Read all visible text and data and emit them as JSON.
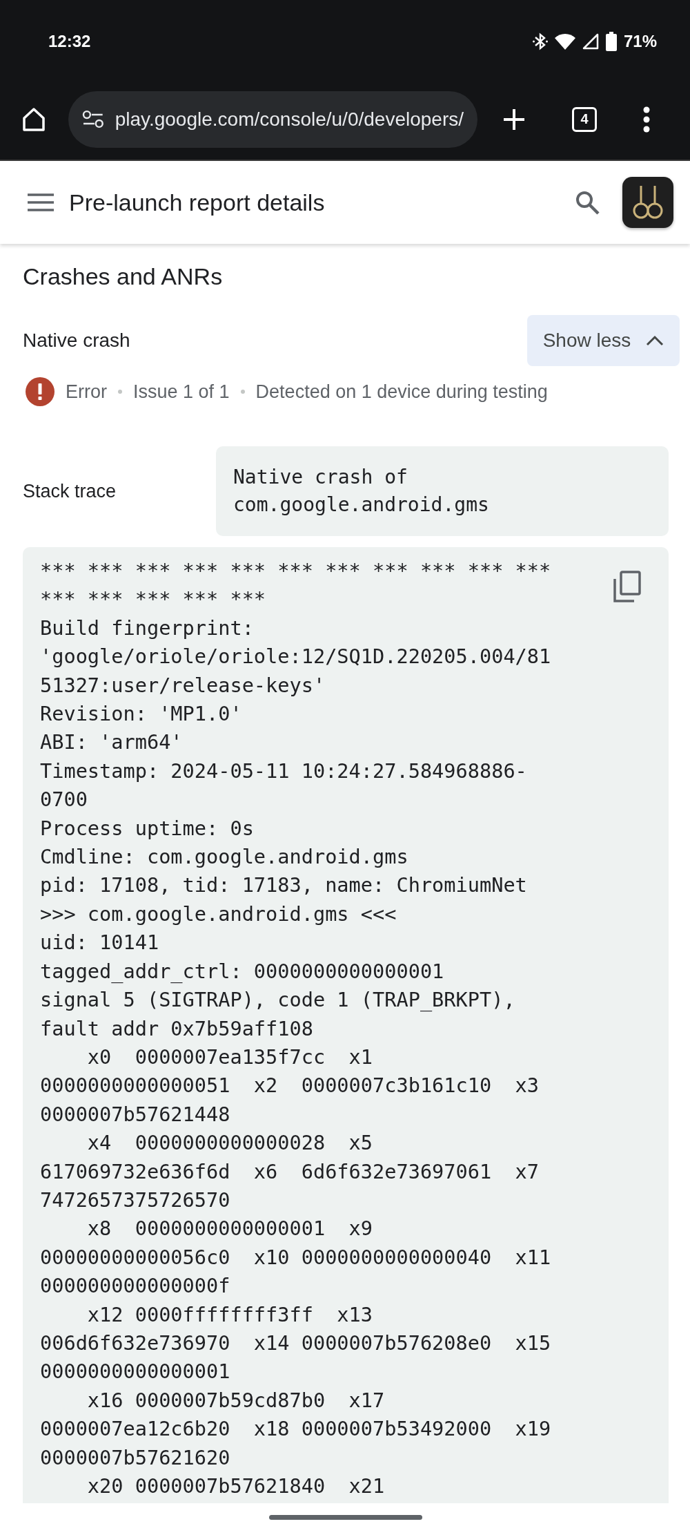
{
  "status_bar": {
    "time": "12:32",
    "battery": "71%"
  },
  "browser": {
    "url": "play.google.com/console/u/0/developers/",
    "tab_count": "4"
  },
  "header": {
    "title": "Pre-launch report details"
  },
  "section": {
    "title": "Crashes and ANRs"
  },
  "issue": {
    "title": "Native crash",
    "toggle_label": "Show less",
    "expanded": true,
    "meta": [
      "Error",
      "Issue 1 of 1",
      "Detected on 1 device during testing"
    ]
  },
  "stack_trace": {
    "label": "Stack trace",
    "summary": "Native crash of com.google.android.gms",
    "lines": [
      "*** *** *** *** *** *** *** *** *** *** ***",
      "*** *** *** *** ***",
      "Build fingerprint:",
      "'google/oriole/oriole:12/SQ1D.220205.004/81",
      "51327:user/release-keys'",
      "Revision: 'MP1.0'",
      "ABI: 'arm64'",
      "Timestamp: 2024-05-11 10:24:27.584968886-",
      "0700",
      "Process uptime: 0s",
      "Cmdline: com.google.android.gms",
      "pid: 17108, tid: 17183, name: ChromiumNet",
      ">>> com.google.android.gms <<<",
      "uid: 10141",
      "tagged_addr_ctrl: 0000000000000001",
      "signal 5 (SIGTRAP), code 1 (TRAP_BRKPT),",
      "fault addr 0x7b59aff108",
      "    x0  0000007ea135f7cc  x1",
      "0000000000000051  x2  0000007c3b161c10  x3",
      "0000007b57621448",
      "    x4  0000000000000028  x5",
      "617069732e636f6d  x6  6d6f632e73697061  x7",
      "7472657375726570",
      "    x8  0000000000000001  x9",
      "00000000000056c0  x10 0000000000000040  x11",
      "000000000000000f",
      "    x12 0000ffffffff3ff  x13",
      "006d6f632e736970  x14 0000007b576208e0  x15",
      "0000000000000001",
      "    x16 0000007b59cd87b0  x17",
      "0000007ea12c6b20  x18 0000007b53492000  x19",
      "0000007b57621620",
      "    x20 0000007b57621840  x21"
    ]
  }
}
